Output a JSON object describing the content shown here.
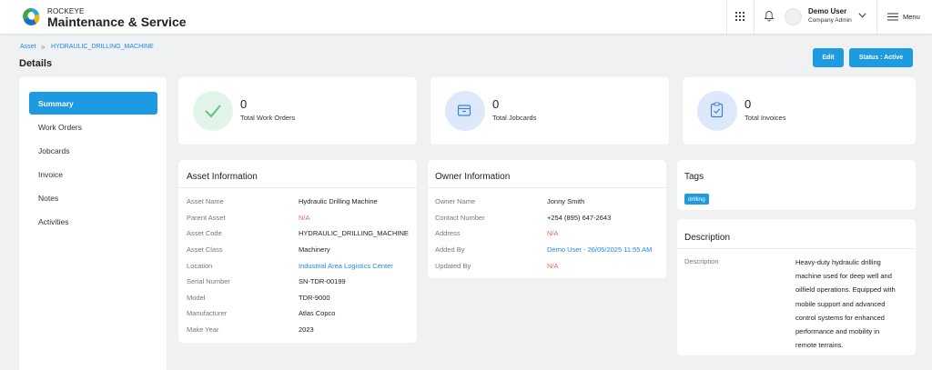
{
  "app": {
    "brand_small": "ROCKEYE",
    "brand_large": "Maintenance & Service",
    "user_name": "Demo User",
    "user_role": "Company Admin",
    "menu_label": "Menu"
  },
  "breadcrumb": {
    "root": "Asset",
    "separator": "»",
    "current": "HYDRAULIC_DRILLING_MACHINE"
  },
  "page": {
    "title": "Details",
    "edit_label": "Edit",
    "status_label": "Status : Active"
  },
  "sidebar": {
    "items": [
      {
        "label": "Summary"
      },
      {
        "label": "Work Orders"
      },
      {
        "label": "Jobcards"
      },
      {
        "label": "Invoice"
      },
      {
        "label": "Notes"
      },
      {
        "label": "Activities"
      }
    ]
  },
  "stats": [
    {
      "value": "0",
      "label": "Total Work Orders",
      "icon": "check-icon"
    },
    {
      "value": "0",
      "label": "Total Jobcards",
      "icon": "jobcard-icon"
    },
    {
      "value": "0",
      "label": "Total Invoices",
      "icon": "invoice-icon"
    }
  ],
  "asset_info": {
    "title": "Asset Information",
    "rows": [
      {
        "label": "Asset Name",
        "value": "Hydraulic Drilling Machine"
      },
      {
        "label": "Parent Asset",
        "value": "N/A"
      },
      {
        "label": "Asset Code",
        "value": "HYDRAULIC_DRILLING_MACHINE"
      },
      {
        "label": "Asset Class",
        "value": "Machinery"
      },
      {
        "label": "Location",
        "value": "Industrial Area Logistics Center"
      },
      {
        "label": "Serial Number",
        "value": "SN-TDR-00199"
      },
      {
        "label": "Model",
        "value": "TDR-9000"
      },
      {
        "label": "Manufacturer",
        "value": "Atlas Copco"
      },
      {
        "label": "Make Year",
        "value": "2023"
      }
    ]
  },
  "owner_info": {
    "title": "Owner Information",
    "rows": [
      {
        "label": "Owner Name",
        "value": "Jonny Smith"
      },
      {
        "label": "Contact Number",
        "value": "+254 (895) 647-2643"
      },
      {
        "label": "Address",
        "value": "N/A"
      },
      {
        "label": "Added By",
        "value": "Demo User - 26/05/2025 11:55 AM"
      },
      {
        "label": "Updated By",
        "value": "N/A"
      }
    ]
  },
  "tags": {
    "title": "Tags",
    "items": [
      "drilling"
    ]
  },
  "description": {
    "title": "Description",
    "label": "Description",
    "lines": [
      "Heavy-duty hydraulic drilling",
      "machine used for deep well and",
      "oilfield operations. Equipped with",
      "mobile support and advanced",
      "control systems for enhanced",
      "performance and mobility in",
      "remote terrains."
    ]
  },
  "colors": {
    "accent": "#1e9be0",
    "link": "#1e88e5",
    "na": "#f06a50"
  }
}
